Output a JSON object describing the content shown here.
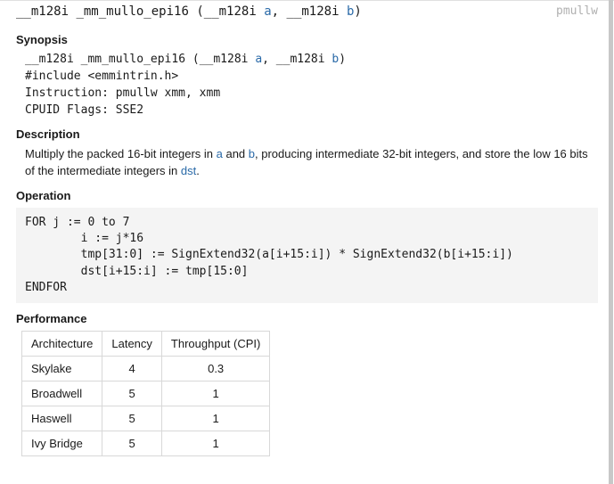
{
  "signature": {
    "ret": "__m128i",
    "name": "_mm_mullo_epi16",
    "params": [
      {
        "type": "__m128i",
        "name": "a"
      },
      {
        "type": "__m128i",
        "name": "b"
      }
    ],
    "instr_short": "pmullw"
  },
  "headings": {
    "synopsis": "Synopsis",
    "description": "Description",
    "operation": "Operation",
    "performance": "Performance"
  },
  "synopsis": {
    "include": "#include <emmintrin.h>",
    "instruction": "Instruction: pmullw xmm, xmm",
    "cpuid": "CPUID Flags: SSE2"
  },
  "description": {
    "t1": "Multiply the packed 16-bit integers in ",
    "p1": "a",
    "t2": " and ",
    "p2": "b",
    "t3": ", producing intermediate 32-bit integers, and store the low 16 bits of the intermediate integers in ",
    "p3": "dst",
    "t4": "."
  },
  "operation": "FOR j := 0 to 7\n        i := j*16\n        tmp[31:0] := SignExtend32(a[i+15:i]) * SignExtend32(b[i+15:i])\n        dst[i+15:i] := tmp[15:0]\nENDFOR",
  "perf": {
    "headers": {
      "arch": "Architecture",
      "lat": "Latency",
      "tp": "Throughput (CPI)"
    },
    "rows": [
      {
        "arch": "Skylake",
        "lat": "4",
        "tp": "0.3"
      },
      {
        "arch": "Broadwell",
        "lat": "5",
        "tp": "1"
      },
      {
        "arch": "Haswell",
        "lat": "5",
        "tp": "1"
      },
      {
        "arch": "Ivy Bridge",
        "lat": "5",
        "tp": "1"
      }
    ]
  }
}
